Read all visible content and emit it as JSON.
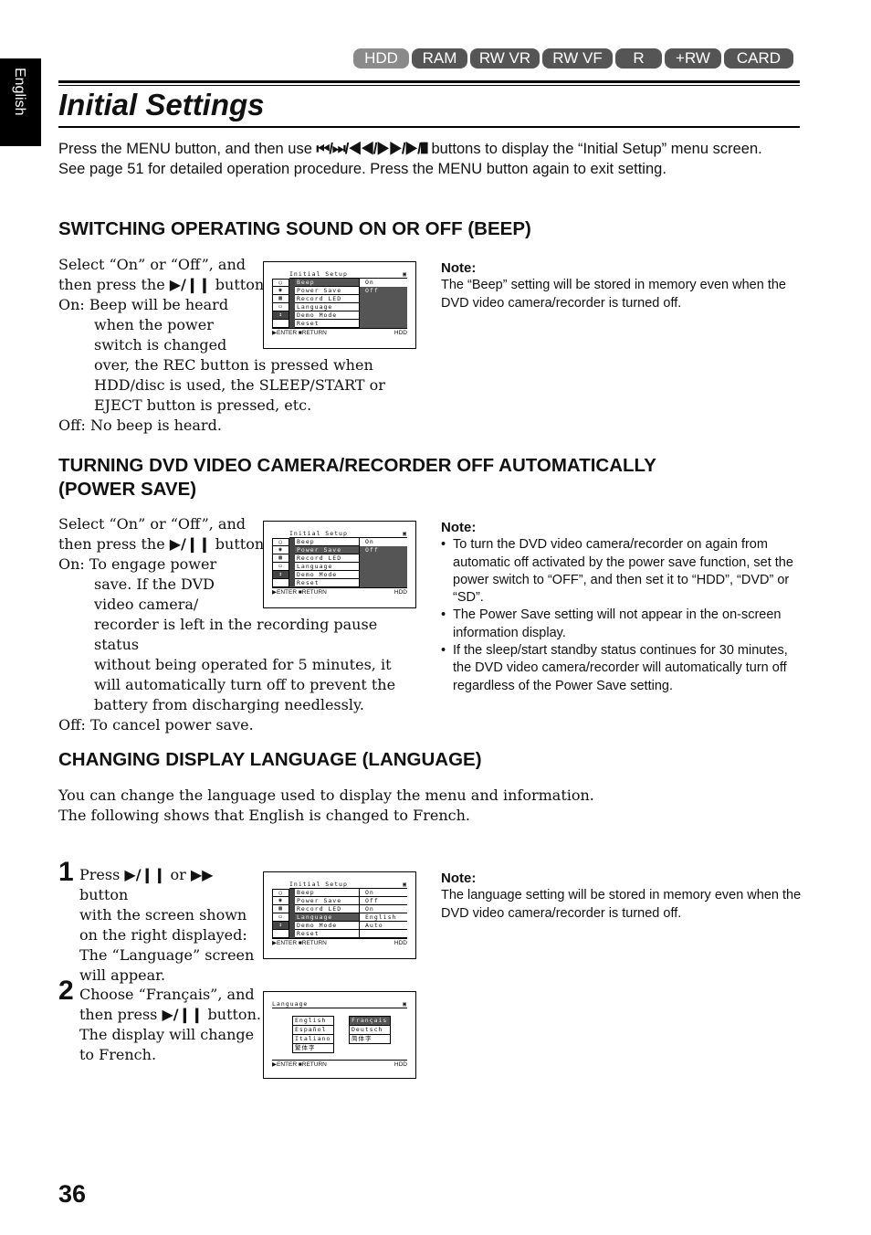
{
  "media_tabs": [
    {
      "label": "HDD",
      "active": true
    },
    {
      "label": "RAM",
      "active": false
    },
    {
      "label": "RW VR",
      "active": false
    },
    {
      "label": "RW VF",
      "active": false
    },
    {
      "label": "R",
      "active": false
    },
    {
      "label": "+RW",
      "active": false
    },
    {
      "label": "CARD",
      "active": false
    }
  ],
  "side_tab": "English",
  "page_title": "Initial Settings",
  "intro": {
    "before": "Press the MENU button, and then use ",
    "buttons": "⏮/⏭/◀◀/▶▶/▶/❙❙",
    "after": " buttons to display the “Initial Setup” menu screen. See page 51 for detailed operation procedure. Press the MENU button again to exit setting."
  },
  "sections": {
    "beep": {
      "heading": "SWITCHING OPERATING SOUND ON OR OFF (BEEP)",
      "line1": "Select “On” or “Off”, and",
      "line2_a": "then press the ",
      "line2_sym": "▶/❙❙",
      "line2_b": " button.",
      "on_label": "On:",
      "on_text": [
        "Beep will be heard",
        "when the power",
        "switch is changed",
        "over, the REC button is pressed when",
        "HDD/disc is used, the SLEEP/START or",
        "EJECT button is pressed, etc."
      ],
      "off_label": "Off:",
      "off_text": "No beep is heard.",
      "note_title": "Note:",
      "note_text": "The “Beep” setting will be stored in memory even when the DVD video camera/recorder is turned off."
    },
    "power_save": {
      "heading_line1": "TURNING DVD VIDEO CAMERA/RECORDER OFF AUTOMATICALLY",
      "heading_line2": "(POWER SAVE)",
      "line1": "Select “On” or “Off”, and",
      "line2_a": "then press the ",
      "line2_sym": "▶/❙❙",
      "line2_b": " button.",
      "on_label": "On:",
      "on_text": [
        "To engage power",
        "save. If the DVD",
        "video camera/",
        "recorder is left in the recording pause status",
        "without being operated for 5 minutes, it",
        "will automatically turn off to prevent the",
        "battery from discharging needlessly."
      ],
      "off_label": "Off:",
      "off_text": "To cancel power save.",
      "note_title": "Note:",
      "note_items": [
        "To turn the DVD video camera/recorder on again from automatic off activated by the power save function, set the power switch to “OFF”, and then set it to “HDD”, “DVD” or “SD”.",
        "The Power Save setting will not appear in the on-screen information display.",
        "If the sleep/start standby status continues for 30 minutes, the DVD video camera/recorder will automatically turn off regardless of the Power Save setting."
      ]
    },
    "language": {
      "heading": "CHANGING DISPLAY LANGUAGE (LANGUAGE)",
      "intro_line1": "You can change the language used to display the menu and information.",
      "intro_line2": "The following shows that English is changed to French.",
      "step1_num": "1",
      "step1_a": "Press ",
      "step1_sym1": "▶/❙❙",
      "step1_b": " or ",
      "step1_sym2": "▶▶",
      "step1_c": " button",
      "step1_lines": [
        "with the screen shown",
        "on the right displayed:",
        "The “Language” screen",
        "will appear."
      ],
      "step2_num": "2",
      "step2_line1": "Choose “Français”, and",
      "step2_a": "then press ",
      "step2_sym": "▶/❙❙",
      "step2_b": " button.",
      "step2_lines": [
        "The display will change",
        "to French."
      ],
      "note_title": "Note:",
      "note_text": "The language setting will be stored in memory even when the DVD video camera/recorder is turned off."
    }
  },
  "lcd": {
    "title": "Initial Setup",
    "items": [
      "Beep",
      "Power Save",
      "Record LED",
      "Language",
      "Demo Mode",
      "Reset"
    ],
    "enter": "ENTER",
    "return": "RETURN",
    "media": "HDD",
    "beep_values": [
      "On",
      "Off"
    ],
    "lang_values": [
      "On",
      "Off",
      "On",
      "English",
      "Auto",
      ""
    ],
    "lang_screen_title": "Language",
    "lang_left": [
      "English",
      "Español",
      "Italiano",
      "繁体字"
    ],
    "lang_right": [
      "Français",
      "Deutsch",
      "简体字"
    ]
  },
  "page_number": "36"
}
